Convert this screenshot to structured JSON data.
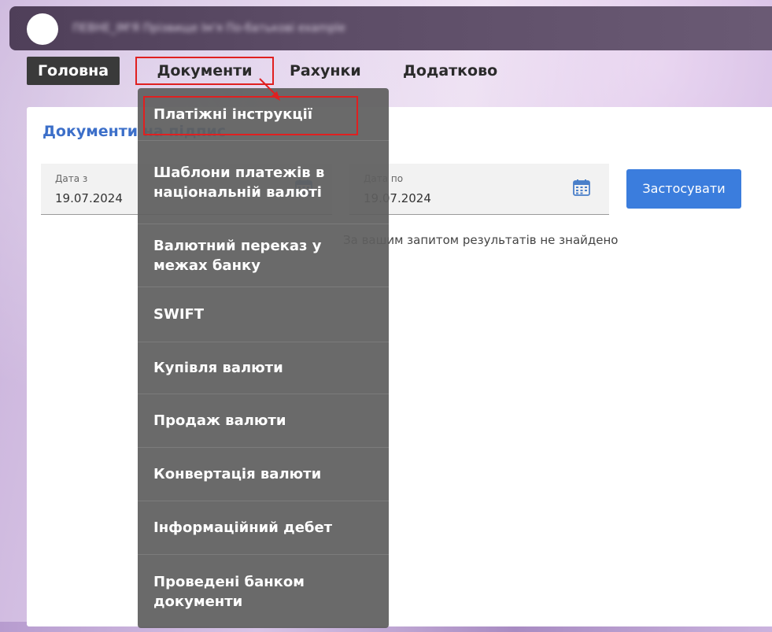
{
  "header": {
    "title_text": "ПЕВНЕ_ІМ'Я Прізвище Ім'я По-батькові example"
  },
  "nav": {
    "home": "Головна",
    "documents": "Документи",
    "accounts": "Рахунки",
    "extra": "Додатково"
  },
  "card": {
    "title": "Документи на підпис",
    "date_from": {
      "label": "Дата з",
      "value": "19.07.2024"
    },
    "date_to": {
      "label": "Дата по",
      "value": "19.07.2024"
    },
    "apply_label": "Застосувати",
    "no_results": "За вашим запитом результатів не знайдено"
  },
  "dropdown": {
    "items": [
      "Платіжні інструкції",
      "Шаблони платежів в національній валюті",
      "Валютний переказ у межах банку",
      "SWIFT",
      "Купівля валюти",
      "Продаж валюти",
      "Конвертація валюти",
      "Інформаційний дебет",
      "Проведені банком документи"
    ]
  },
  "colors": {
    "accent": "#3b7ddd",
    "highlight": "#e02020",
    "menu_bg": "#5f5f5f",
    "topbar": "#4f3f59"
  }
}
